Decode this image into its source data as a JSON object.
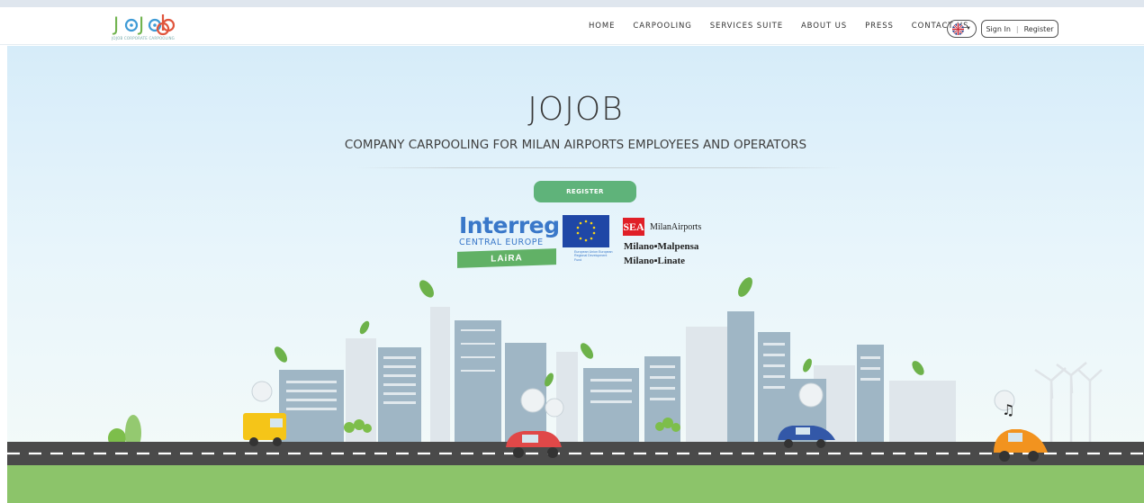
{
  "header": {
    "logo_subtitle": "JOJOB CORPORATE CARPOOLING",
    "nav": [
      {
        "label": "HOME"
      },
      {
        "label": "CARPOOLING"
      },
      {
        "label": "SERVICES SUITE"
      },
      {
        "label": "ABOUT US"
      },
      {
        "label": "PRESS"
      },
      {
        "label": "CONTACT US"
      }
    ],
    "language": "uk-flag-icon",
    "sign_in": "Sign In",
    "register": "Register"
  },
  "hero": {
    "title": "JOJOB",
    "subtitle": "COMPANY CARPOOLING FOR MILAN AIRPORTS EMPLOYEES AND OPERATORS",
    "register_button": "REGISTER"
  },
  "partners": {
    "interreg": "Interreg",
    "central_europe": "CENTRAL EUROPE",
    "laira": "LAiRA",
    "eu_text": "European Union European Regional Development Fund",
    "sea": "SEA",
    "milan_airports": "MilanAirports",
    "malpensa": "Milano▪Malpensa",
    "linate": "Milano▪Linate"
  },
  "colors": {
    "accent_green": "#5fb37a",
    "interreg_blue": "#3a78c9",
    "sea_red": "#e01f27",
    "road": "#4a4a4a",
    "grass": "#8cc46a"
  }
}
